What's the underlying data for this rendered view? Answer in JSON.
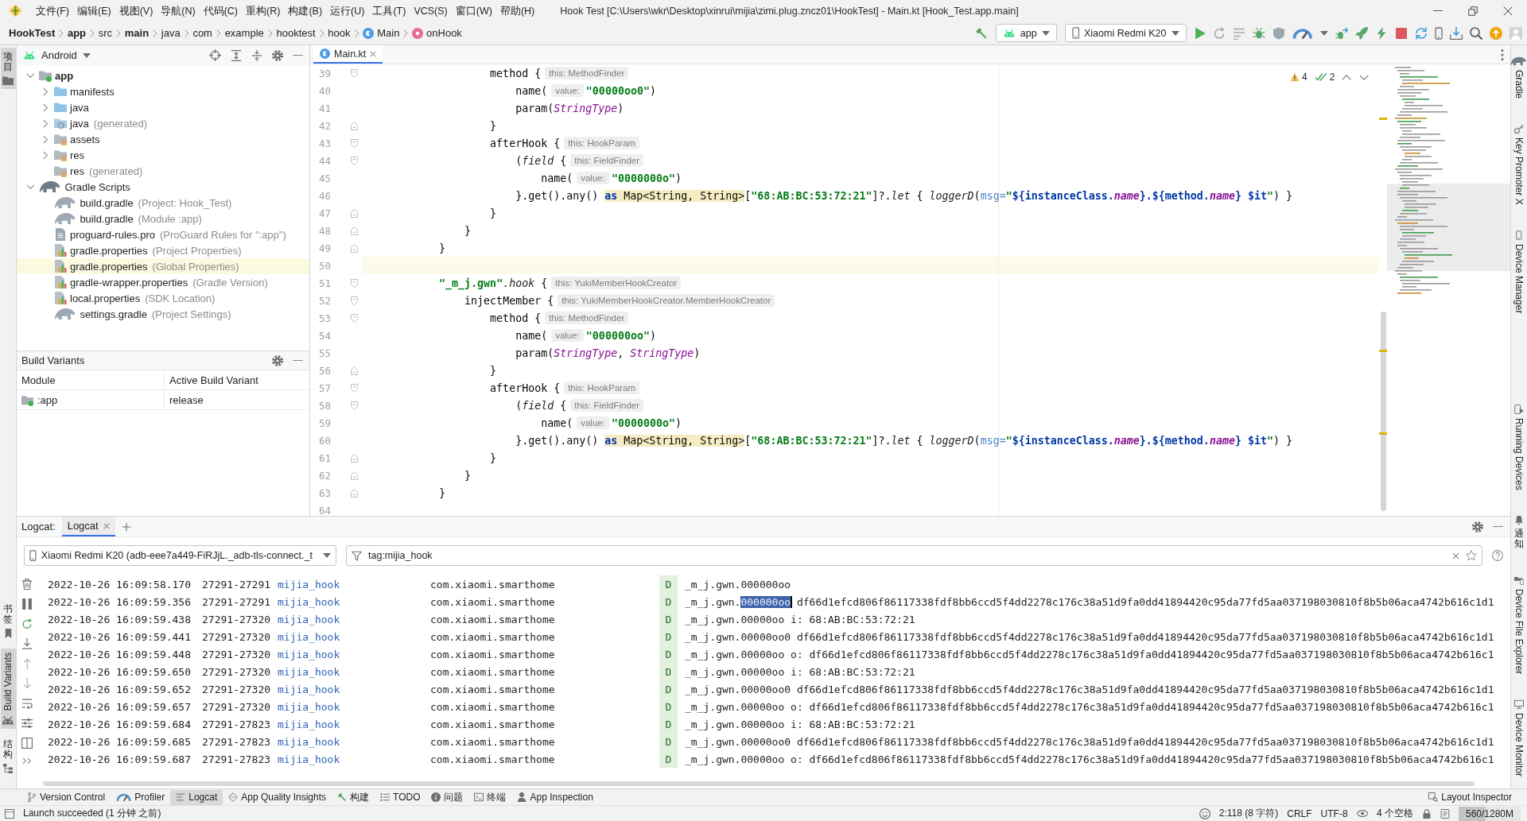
{
  "title_bar": {
    "menus": [
      "文件(F)",
      "编辑(E)",
      "视图(V)",
      "导航(N)",
      "代码(C)",
      "重构(R)",
      "构建(B)",
      "运行(U)",
      "工具(T)",
      "VCS(S)",
      "窗口(W)",
      "帮助(H)"
    ],
    "title": "Hook Test [C:\\Users\\wkr\\Desktop\\xinrui\\mijia\\zimi.plug.zncz01\\HookTest] - Main.kt [Hook_Test.app.main]"
  },
  "nav_bar": {
    "breadcrumbs": [
      {
        "label": "HookTest",
        "kind": "module"
      },
      {
        "label": "app",
        "kind": "module"
      },
      {
        "label": "src",
        "kind": "folder"
      },
      {
        "label": "main",
        "kind": "module"
      },
      {
        "label": "java",
        "kind": "folder"
      },
      {
        "label": "com",
        "kind": "folder"
      },
      {
        "label": "example",
        "kind": "folder"
      },
      {
        "label": "hooktest",
        "kind": "folder"
      },
      {
        "label": "hook",
        "kind": "folder"
      },
      {
        "label": "Main",
        "kind": "class"
      },
      {
        "label": "onHook",
        "kind": "method"
      }
    ],
    "run_config": "app",
    "device": "Xiaomi Redmi K20"
  },
  "left_strip": {
    "top": [
      {
        "label": "项目",
        "kind": "stacked",
        "selected": true
      }
    ],
    "bottom": [
      {
        "label": "书签",
        "kind": "stacked",
        "selected": false
      },
      {
        "label": "Build Variants",
        "kind": "rotated",
        "selected": true
      },
      {
        "label": "结构",
        "kind": "stacked",
        "selected": false
      }
    ]
  },
  "project_panel": {
    "view": "Android",
    "tree": [
      {
        "label": "app",
        "kind": "module",
        "expanded": true,
        "highlighted": false,
        "children": [
          {
            "label": "manifests",
            "kind": "folder",
            "expanded": false,
            "highlighted": false
          },
          {
            "label": "java",
            "kind": "folder",
            "expanded": false,
            "highlighted": false
          },
          {
            "label": "java",
            "hint": "(generated)",
            "kind": "generated-folder",
            "expanded": false,
            "highlighted": false
          },
          {
            "label": "assets",
            "kind": "res-folder",
            "expanded": false,
            "highlighted": false
          },
          {
            "label": "res",
            "kind": "res-folder",
            "expanded": false,
            "highlighted": false
          },
          {
            "label": "res",
            "hint": "(generated)",
            "kind": "res-folder",
            "highlighted": false
          }
        ]
      },
      {
        "label": "Gradle Scripts",
        "kind": "gradle-group",
        "expanded": true,
        "highlighted": false,
        "children": [
          {
            "label": "build.gradle",
            "hint": "(Project: Hook_Test)",
            "kind": "gradle",
            "highlighted": false
          },
          {
            "label": "build.gradle",
            "hint": "(Module :app)",
            "kind": "gradle",
            "highlighted": false
          },
          {
            "label": "proguard-rules.pro",
            "hint": "(ProGuard Rules for \":app\")",
            "kind": "text",
            "highlighted": false
          },
          {
            "label": "gradle.properties",
            "hint": "(Project Properties)",
            "kind": "properties",
            "highlighted": false
          },
          {
            "label": "gradle.properties",
            "hint": "(Global Properties)",
            "kind": "properties",
            "highlighted": true
          },
          {
            "label": "gradle-wrapper.properties",
            "hint": "(Gradle Version)",
            "kind": "properties",
            "highlighted": false
          },
          {
            "label": "local.properties",
            "hint": "(SDK Location)",
            "kind": "properties",
            "highlighted": false
          },
          {
            "label": "settings.gradle",
            "hint": "(Project Settings)",
            "kind": "gradle",
            "highlighted": false
          }
        ]
      }
    ]
  },
  "build_variants": {
    "title": "Build Variants",
    "columns": [
      "Module",
      "Active Build Variant"
    ],
    "rows": [
      {
        "cells": [
          ":app",
          "release"
        ]
      }
    ]
  },
  "editor": {
    "tabs": [
      {
        "label": "Main.kt",
        "selected": true
      }
    ],
    "inspections": {
      "warnings": "4",
      "weak_warnings": "2"
    },
    "lines": [
      {
        "number": "39",
        "kind": "opener",
        "current": false,
        "tokens": [
          {
            "text": "                    method {",
            "kind": "plain"
          },
          {
            "text": "this: MethodFinder",
            "kind": "hint"
          }
        ]
      },
      {
        "number": "40",
        "kind": "plain",
        "current": false,
        "tokens": [
          {
            "text": "                        name(",
            "kind": "plain"
          },
          {
            "text": "value:",
            "kind": "hint"
          },
          {
            "text": "\"00000oo0\"",
            "kind": "string"
          },
          {
            "text": ")",
            "kind": "plain"
          }
        ]
      },
      {
        "number": "41",
        "kind": "plain",
        "current": false,
        "tokens": [
          {
            "text": "                        param(",
            "kind": "plain"
          },
          {
            "text": "StringType",
            "kind": "type"
          },
          {
            "text": ")",
            "kind": "plain"
          }
        ]
      },
      {
        "number": "42",
        "kind": "closer",
        "current": false,
        "tokens": [
          {
            "text": "                    }",
            "kind": "plain"
          }
        ]
      },
      {
        "number": "43",
        "kind": "opener",
        "current": false,
        "tokens": [
          {
            "text": "                    afterHook {",
            "kind": "plain"
          },
          {
            "text": "this: HookParam",
            "kind": "hint"
          }
        ]
      },
      {
        "number": "44",
        "kind": "opener",
        "current": false,
        "tokens": [
          {
            "text": "                        (",
            "kind": "plain"
          },
          {
            "text": "field",
            "kind": "italic"
          },
          {
            "text": " {",
            "kind": "plain"
          },
          {
            "text": "this: FieldFinder",
            "kind": "hint"
          }
        ]
      },
      {
        "number": "45",
        "kind": "plain",
        "current": false,
        "tokens": [
          {
            "text": "                            name(",
            "kind": "plain"
          },
          {
            "text": "value:",
            "kind": "hint"
          },
          {
            "text": "\"0000000o\"",
            "kind": "string"
          },
          {
            "text": ")",
            "kind": "plain"
          }
        ]
      },
      {
        "number": "46",
        "kind": "plain",
        "current": false,
        "tokens": [
          {
            "text": "                        }.get().any() ",
            "kind": "plain"
          },
          {
            "text": "as",
            "kind": "cast-keyword"
          },
          {
            "text": " Map<String, String>",
            "kind": "cast"
          },
          {
            "text": "[",
            "kind": "plain"
          },
          {
            "text": "\"68:AB:BC:53:72:21\"",
            "kind": "string"
          },
          {
            "text": "]?.",
            "kind": "plain"
          },
          {
            "text": "let",
            "kind": "italic"
          },
          {
            "text": " { ",
            "kind": "plain"
          },
          {
            "text": "loggerD",
            "kind": "italic"
          },
          {
            "text": "(",
            "kind": "plain"
          },
          {
            "text": "msg=",
            "kind": "param"
          },
          {
            "text": "\"",
            "kind": "string"
          },
          {
            "text": "${instanceClass.",
            "kind": "template"
          },
          {
            "text": "name",
            "kind": "property"
          },
          {
            "text": "}",
            "kind": "template"
          },
          {
            "text": ".${method.",
            "kind": "template"
          },
          {
            "text": "name",
            "kind": "property"
          },
          {
            "text": "} $it",
            "kind": "template"
          },
          {
            "text": "\"",
            "kind": "string"
          },
          {
            "text": ") }",
            "kind": "plain"
          }
        ]
      },
      {
        "number": "47",
        "kind": "closer",
        "current": false,
        "tokens": [
          {
            "text": "                    }",
            "kind": "plain"
          }
        ]
      },
      {
        "number": "48",
        "kind": "closer",
        "current": false,
        "tokens": [
          {
            "text": "                }",
            "kind": "plain"
          }
        ]
      },
      {
        "number": "49",
        "kind": "closer",
        "current": false,
        "tokens": [
          {
            "text": "            }",
            "kind": "plain"
          }
        ]
      },
      {
        "number": "50",
        "kind": "plain",
        "current": true
      },
      {
        "number": "51",
        "kind": "opener",
        "current": false,
        "tokens": [
          {
            "text": "            \"_m_j.gwn\"",
            "kind": "string"
          },
          {
            "text": ".hook",
            "kind": "italic"
          },
          {
            "text": " {",
            "kind": "plain"
          },
          {
            "text": "this: YukiMemberHookCreator",
            "kind": "hint"
          }
        ]
      },
      {
        "number": "52",
        "kind": "opener",
        "current": false,
        "tokens": [
          {
            "text": "                injectMember {",
            "kind": "plain"
          },
          {
            "text": "this: YukiMemberHookCreator.MemberHookCreator",
            "kind": "hint"
          }
        ]
      },
      {
        "number": "53",
        "kind": "opener",
        "current": false,
        "tokens": [
          {
            "text": "                    method {",
            "kind": "plain"
          },
          {
            "text": "this: MethodFinder",
            "kind": "hint"
          }
        ]
      },
      {
        "number": "54",
        "kind": "plain",
        "current": false,
        "tokens": [
          {
            "text": "                        name(",
            "kind": "plain"
          },
          {
            "text": "value:",
            "kind": "hint"
          },
          {
            "text": "\"000000oo\"",
            "kind": "string"
          },
          {
            "text": ")",
            "kind": "plain"
          }
        ]
      },
      {
        "number": "55",
        "kind": "plain",
        "current": false,
        "tokens": [
          {
            "text": "                        param(",
            "kind": "plain"
          },
          {
            "text": "StringType",
            "kind": "type"
          },
          {
            "text": ", ",
            "kind": "plain"
          },
          {
            "text": "StringType",
            "kind": "type"
          },
          {
            "text": ")",
            "kind": "plain"
          }
        ]
      },
      {
        "number": "56",
        "kind": "closer",
        "current": false,
        "tokens": [
          {
            "text": "                    }",
            "kind": "plain"
          }
        ]
      },
      {
        "number": "57",
        "kind": "opener",
        "current": false,
        "tokens": [
          {
            "text": "                    afterHook {",
            "kind": "plain"
          },
          {
            "text": "this: HookParam",
            "kind": "hint"
          }
        ]
      },
      {
        "number": "58",
        "kind": "opener",
        "current": false,
        "tokens": [
          {
            "text": "                        (",
            "kind": "plain"
          },
          {
            "text": "field",
            "kind": "italic"
          },
          {
            "text": " {",
            "kind": "plain"
          },
          {
            "text": "this: FieldFinder",
            "kind": "hint"
          }
        ]
      },
      {
        "number": "59",
        "kind": "plain",
        "current": false,
        "tokens": [
          {
            "text": "                            name(",
            "kind": "plain"
          },
          {
            "text": "value:",
            "kind": "hint"
          },
          {
            "text": "\"0000000o\"",
            "kind": "string"
          },
          {
            "text": ")",
            "kind": "plain"
          }
        ]
      },
      {
        "number": "60",
        "kind": "plain",
        "current": false,
        "tokens": [
          {
            "text": "                        }.get().any() ",
            "kind": "plain"
          },
          {
            "text": "as",
            "kind": "cast-keyword"
          },
          {
            "text": " Map<String, String>",
            "kind": "cast"
          },
          {
            "text": "[",
            "kind": "plain"
          },
          {
            "text": "\"68:AB:BC:53:72:21\"",
            "kind": "string"
          },
          {
            "text": "]?.",
            "kind": "plain"
          },
          {
            "text": "let",
            "kind": "italic"
          },
          {
            "text": " { ",
            "kind": "plain"
          },
          {
            "text": "loggerD",
            "kind": "italic"
          },
          {
            "text": "(",
            "kind": "plain"
          },
          {
            "text": "msg=",
            "kind": "param"
          },
          {
            "text": "\"",
            "kind": "string"
          },
          {
            "text": "${instanceClass.",
            "kind": "template"
          },
          {
            "text": "name",
            "kind": "property"
          },
          {
            "text": "}",
            "kind": "template"
          },
          {
            "text": ".${method.",
            "kind": "template"
          },
          {
            "text": "name",
            "kind": "property"
          },
          {
            "text": "} $it",
            "kind": "template"
          },
          {
            "text": "\"",
            "kind": "string"
          },
          {
            "text": ") }",
            "kind": "plain"
          }
        ]
      },
      {
        "number": "61",
        "kind": "closer",
        "current": false,
        "tokens": [
          {
            "text": "                    }",
            "kind": "plain"
          }
        ]
      },
      {
        "number": "62",
        "kind": "closer",
        "current": false,
        "tokens": [
          {
            "text": "                }",
            "kind": "plain"
          }
        ]
      },
      {
        "number": "63",
        "kind": "closer",
        "current": false,
        "tokens": [
          {
            "text": "            }",
            "kind": "plain"
          }
        ]
      },
      {
        "number": "64",
        "kind": "plain",
        "current": false
      }
    ]
  },
  "right_strip": {
    "top": [
      {
        "label": "Gradle",
        "kind": "rotated"
      },
      {
        "label": "Key Promoter X",
        "kind": "rotated"
      },
      {
        "label": "Device Manager",
        "kind": "rotated"
      }
    ],
    "bottom": [
      {
        "label": "Running Devices",
        "kind": "rotated"
      },
      {
        "label": "通知",
        "kind": "stacked"
      },
      {
        "label": "Device File Explorer",
        "kind": "rotated"
      },
      {
        "label": "Device Monitor",
        "kind": "rotated"
      }
    ]
  },
  "logcat": {
    "title": "Logcat:",
    "tabs": [
      {
        "label": "Logcat",
        "selected": true
      }
    ],
    "device": "Xiaomi Redmi K20 (adb-eee7a449-FiRJjL._adb-tls-connect._t",
    "filter": "tag:mijia_hook",
    "rows": [
      {
        "time": "2022-10-26 16:09:58.170",
        "pid_tid": "27291-27291",
        "tag": "mijia_hook",
        "package": "com.xiaomi.smarthome",
        "priority": "D",
        "message": [
          {
            "text": "_m_j.gwn.000000oo",
            "selected": false
          }
        ]
      },
      {
        "time": "2022-10-26 16:09:59.356",
        "pid_tid": "27291-27291",
        "tag": "mijia_hook",
        "package": "com.xiaomi.smarthome",
        "priority": "D",
        "message": [
          {
            "text": "_m_j.gwn.",
            "selected": false
          },
          {
            "text": "000000oo",
            "selected": true
          },
          {
            "text": " df66d1efcd806f86117338fdf8bb6ccd5f4dd2278c176c38a51d9fa0dd41894420c95da77fd5aa037198030810f8b5b06aca4742b616c1d1",
            "selected": false
          }
        ]
      },
      {
        "time": "2022-10-26 16:09:59.438",
        "pid_tid": "27291-27320",
        "tag": "mijia_hook",
        "package": "com.xiaomi.smarthome",
        "priority": "D",
        "message": [
          {
            "text": "_m_j.gwn.00000oo i: 68:AB:BC:53:72:21",
            "selected": false
          }
        ]
      },
      {
        "time": "2022-10-26 16:09:59.441",
        "pid_tid": "27291-27320",
        "tag": "mijia_hook",
        "package": "com.xiaomi.smarthome",
        "priority": "D",
        "message": [
          {
            "text": "_m_j.gwn.00000oo0 df66d1efcd806f86117338fdf8bb6ccd5f4dd2278c176c38a51d9fa0dd41894420c95da77fd5aa037198030810f8b5b06aca4742b616c1d1",
            "selected": false
          }
        ]
      },
      {
        "time": "2022-10-26 16:09:59.448",
        "pid_tid": "27291-27320",
        "tag": "mijia_hook",
        "package": "com.xiaomi.smarthome",
        "priority": "D",
        "message": [
          {
            "text": "_m_j.gwn.00000oo o: df66d1efcd806f86117338fdf8bb6ccd5f4dd2278c176c38a51d9fa0dd41894420c95da77fd5aa037198030810f8b5b06aca4742b616c1",
            "selected": false
          }
        ]
      },
      {
        "time": "2022-10-26 16:09:59.650",
        "pid_tid": "27291-27320",
        "tag": "mijia_hook",
        "package": "com.xiaomi.smarthome",
        "priority": "D",
        "message": [
          {
            "text": "_m_j.gwn.00000oo i: 68:AB:BC:53:72:21",
            "selected": false
          }
        ]
      },
      {
        "time": "2022-10-26 16:09:59.652",
        "pid_tid": "27291-27320",
        "tag": "mijia_hook",
        "package": "com.xiaomi.smarthome",
        "priority": "D",
        "message": [
          {
            "text": "_m_j.gwn.00000oo0 df66d1efcd806f86117338fdf8bb6ccd5f4dd2278c176c38a51d9fa0dd41894420c95da77fd5aa037198030810f8b5b06aca4742b616c1d1",
            "selected": false
          }
        ]
      },
      {
        "time": "2022-10-26 16:09:59.657",
        "pid_tid": "27291-27320",
        "tag": "mijia_hook",
        "package": "com.xiaomi.smarthome",
        "priority": "D",
        "message": [
          {
            "text": "_m_j.gwn.00000oo o: df66d1efcd806f86117338fdf8bb6ccd5f4dd2278c176c38a51d9fa0dd41894420c95da77fd5aa037198030810f8b5b06aca4742b616c1",
            "selected": false
          }
        ]
      },
      {
        "time": "2022-10-26 16:09:59.684",
        "pid_tid": "27291-27823",
        "tag": "mijia_hook",
        "package": "com.xiaomi.smarthome",
        "priority": "D",
        "message": [
          {
            "text": "_m_j.gwn.00000oo i: 68:AB:BC:53:72:21",
            "selected": false
          }
        ]
      },
      {
        "time": "2022-10-26 16:09:59.685",
        "pid_tid": "27291-27823",
        "tag": "mijia_hook",
        "package": "com.xiaomi.smarthome",
        "priority": "D",
        "message": [
          {
            "text": "_m_j.gwn.00000oo0 df66d1efcd806f86117338fdf8bb6ccd5f4dd2278c176c38a51d9fa0dd41894420c95da77fd5aa037198030810f8b5b06aca4742b616c1d1",
            "selected": false
          }
        ]
      },
      {
        "time": "2022-10-26 16:09:59.687",
        "pid_tid": "27291-27823",
        "tag": "mijia_hook",
        "package": "com.xiaomi.smarthome",
        "priority": "D",
        "message": [
          {
            "text": "_m_j.gwn.00000oo o: df66d1efcd806f86117338fdf8bb6ccd5f4dd2278c176c38a51d9fa0dd41894420c95da77fd5aa037198030810f8b5b06aca4742b616c1",
            "selected": false
          }
        ]
      }
    ]
  },
  "bottom_bar": {
    "tools": [
      {
        "label": "Version Control",
        "selected": false
      },
      {
        "label": "Profiler",
        "selected": false
      },
      {
        "label": "Logcat",
        "selected": true
      },
      {
        "label": "App Quality Insights",
        "selected": false
      },
      {
        "label": "构建",
        "selected": false
      },
      {
        "label": "TODO",
        "selected": false
      },
      {
        "label": "问题",
        "selected": false
      },
      {
        "label": "终端",
        "selected": false
      },
      {
        "label": "App Inspection",
        "selected": false
      }
    ],
    "right_tools": [
      {
        "label": "Layout Inspector",
        "selected": false
      }
    ]
  },
  "status_bar": {
    "message": "Launch succeeded (1 分钟 之前)",
    "position": "2:118 (8 字符)",
    "line_separator": "CRLF",
    "encoding": "UTF-8",
    "indent": "4 个空格",
    "memory": {
      "text": "560/1280M",
      "level": 0.44
    }
  }
}
